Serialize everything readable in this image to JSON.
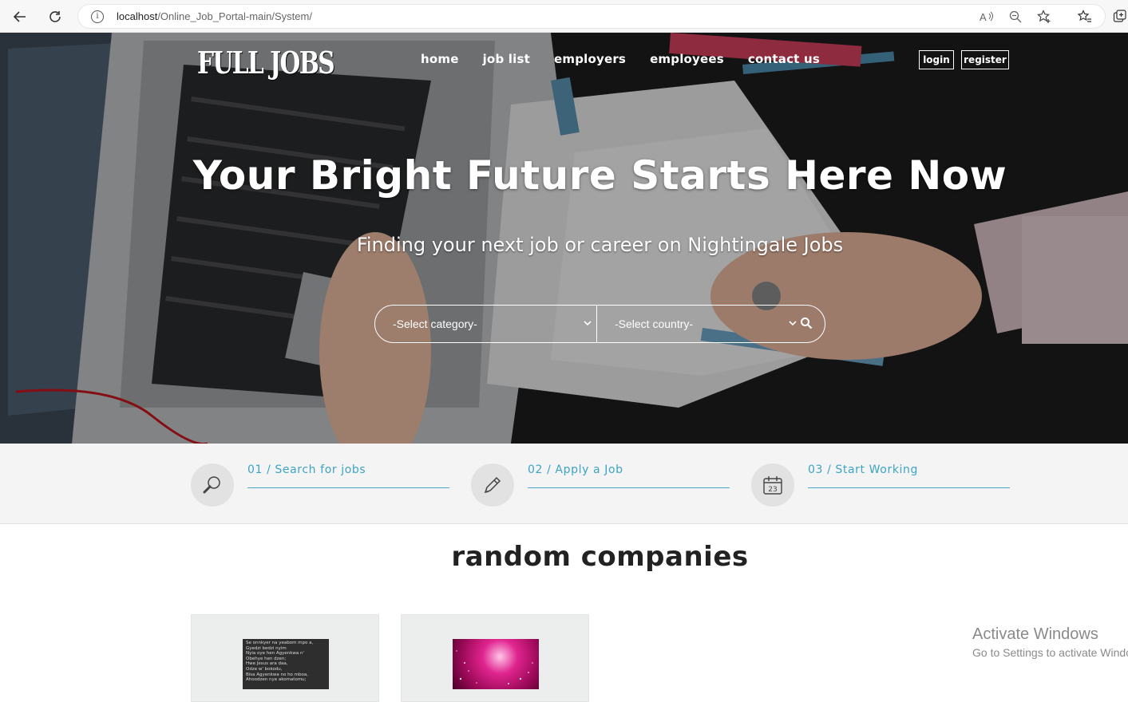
{
  "browser": {
    "url_host": "localhost",
    "url_path": "/Online_Job_Portal-main/System/",
    "info_symbol": "i"
  },
  "header": {
    "logo": "FULL JOBS",
    "nav": [
      "home",
      "job list",
      "employers",
      "employees",
      "contact us"
    ],
    "login": "login",
    "register": "register"
  },
  "hero": {
    "title": "Your Bright Future Starts Here Now",
    "subtitle": "Finding your next job or career on Nightingale Jobs",
    "category_select": "-Select category-",
    "country_select": "-Select country-"
  },
  "steps": [
    {
      "label": "01 / Search for jobs",
      "icon": "magnifier-icon"
    },
    {
      "label": "02 / Apply a Job",
      "icon": "pencil-icon"
    },
    {
      "label": "03 / Start Working",
      "icon": "calendar-icon",
      "calendar_day": "23"
    }
  ],
  "companies": {
    "title": "random companies",
    "card1_text": [
      "Se onnkyer na yeabom mpo a,",
      "Gyedzi bedzi nyim",
      "Nyia oye hen Agyenkwa n'",
      "Obehye hen dzen;",
      "Hwe Jesus ara daa,",
      "Odze w' bokodu,",
      "Bisa Agyenkwa no ho mboa,",
      "Ahoodzen nye akomatomu;"
    ]
  },
  "watermark": {
    "line1": "Activate Windows",
    "line2": "Go to Settings to activate Windows."
  },
  "colors": {
    "accent": "#3ea4c4",
    "steps_bg": "#f3f4f3"
  }
}
